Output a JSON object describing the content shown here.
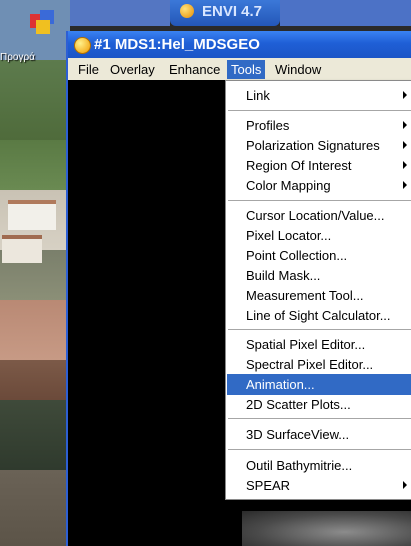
{
  "desktop": {
    "icon_label": "Προγρά"
  },
  "background_window": {
    "title": "ENVI 4.7"
  },
  "window": {
    "title": "#1 MDS1:Hel_MDSGEO"
  },
  "menubar": {
    "items": [
      "File",
      "Overlay",
      "Enhance",
      "Tools",
      "Window"
    ],
    "active": "Tools"
  },
  "tools_menu": {
    "items": [
      {
        "label": "Link",
        "submenu": true
      },
      {
        "label": "Profiles",
        "submenu": true
      },
      {
        "label": "Polarization Signatures",
        "submenu": true
      },
      {
        "label": "Region Of Interest",
        "submenu": true
      },
      {
        "label": "Color Mapping",
        "submenu": true
      },
      {
        "label": "Cursor Location/Value...",
        "submenu": false
      },
      {
        "label": "Pixel Locator...",
        "submenu": false
      },
      {
        "label": "Point Collection...",
        "submenu": false
      },
      {
        "label": "Build Mask...",
        "submenu": false
      },
      {
        "label": "Measurement Tool...",
        "submenu": false
      },
      {
        "label": "Line of Sight Calculator...",
        "submenu": false
      },
      {
        "label": "Spatial Pixel Editor...",
        "submenu": false
      },
      {
        "label": "Spectral Pixel Editor...",
        "submenu": false
      },
      {
        "label": "Animation...",
        "submenu": false,
        "highlighted": true
      },
      {
        "label": "2D Scatter Plots...",
        "submenu": false
      },
      {
        "label": "3D SurfaceView...",
        "submenu": false
      },
      {
        "label": "Outil Bathymitrie...",
        "submenu": false
      },
      {
        "label": "SPEAR",
        "submenu": true
      }
    ]
  },
  "colors": {
    "titlebar": "#1f5fd6",
    "highlight": "#316ac5",
    "menu_bg": "#ffffff",
    "menubar_bg": "#ece9d8"
  }
}
